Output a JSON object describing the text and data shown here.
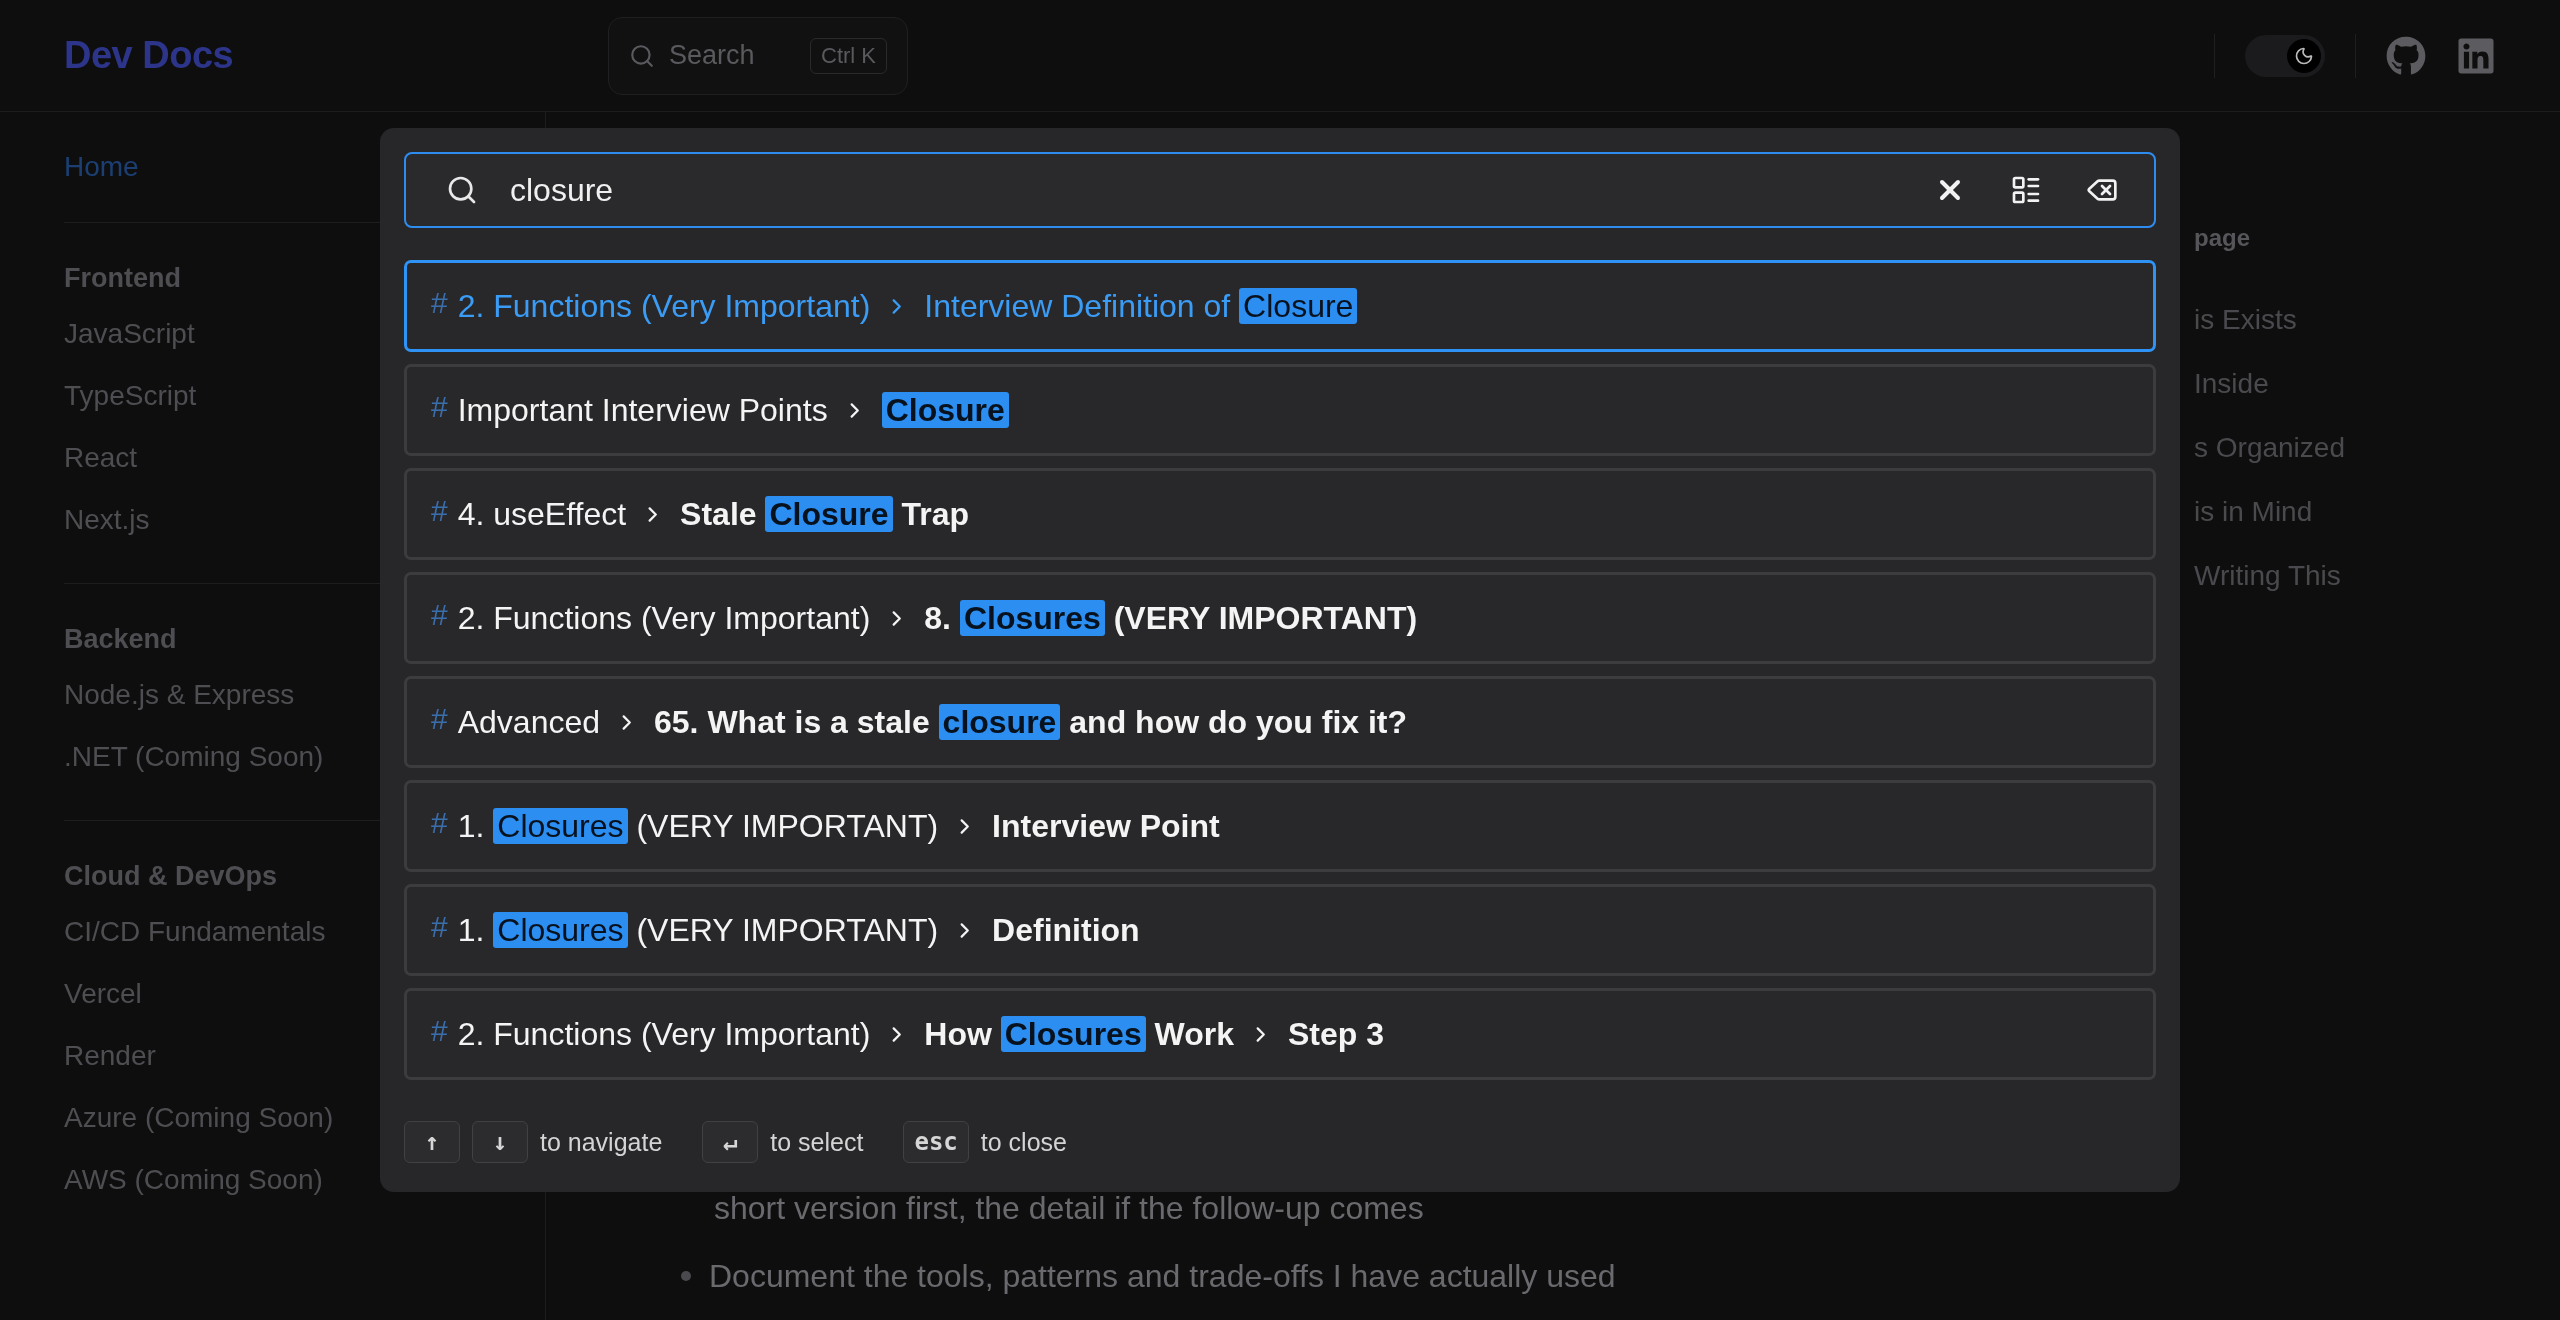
{
  "header": {
    "logo": "Dev Docs",
    "search": {
      "label": "Search",
      "shortcut": "Ctrl K"
    },
    "theme_toggle": {
      "on": true
    }
  },
  "sidebar": {
    "items": [
      {
        "label": "Home",
        "selected": true
      }
    ],
    "sections": [
      {
        "title": "Frontend",
        "items": [
          {
            "label": "JavaScript",
            "selected": false
          },
          {
            "label": "TypeScript",
            "selected": false
          },
          {
            "label": "React",
            "selected": false
          },
          {
            "label": "Next.js",
            "selected": false
          }
        ]
      },
      {
        "title": "Backend",
        "items": [
          {
            "label": "Node.js & Express",
            "selected": false
          },
          {
            "label": ".NET (Coming Soon)",
            "selected": false
          }
        ]
      },
      {
        "title": "Cloud & DevOps",
        "items": [
          {
            "label": "CI/CD Fundamentals",
            "selected": false
          },
          {
            "label": "Vercel",
            "selected": false
          },
          {
            "label": "Render",
            "selected": false
          },
          {
            "label": "Azure (Coming Soon)",
            "selected": false
          },
          {
            "label": "AWS (Coming Soon)",
            "selected": false
          }
        ]
      }
    ]
  },
  "content": {
    "lines": [
      {
        "kind": "continuation",
        "text": "short version first, the detail if the follow-up comes"
      },
      {
        "kind": "bullet",
        "text": "Document the tools, patterns and trade-offs I have actually used"
      }
    ]
  },
  "toc": {
    "heading": "page",
    "items": [
      "is Exists",
      "Inside",
      "s Organized",
      "is in Mind",
      "Writing This"
    ]
  },
  "search_dialog": {
    "query": "closure",
    "results": [
      {
        "icon": "#",
        "selected": true,
        "crumbs": [
          [
            {
              "text": "2. Functions (Very Important)",
              "highlight": false
            }
          ],
          [
            {
              "text": "Interview Definition of ",
              "highlight": false
            },
            {
              "text": "Closure",
              "highlight": true
            }
          ]
        ]
      },
      {
        "icon": "#",
        "selected": false,
        "crumbs": [
          [
            {
              "text": "Important Interview Points",
              "highlight": false
            }
          ],
          [
            {
              "text": "Closure",
              "highlight": true
            }
          ]
        ]
      },
      {
        "icon": "#",
        "selected": false,
        "crumbs": [
          [
            {
              "text": "4. useEffect",
              "highlight": false
            }
          ],
          [
            {
              "text": "Stale ",
              "highlight": false
            },
            {
              "text": "Closure",
              "highlight": true
            },
            {
              "text": " Trap",
              "highlight": false
            }
          ]
        ]
      },
      {
        "icon": "#",
        "selected": false,
        "crumbs": [
          [
            {
              "text": "2. Functions (Very Important)",
              "highlight": false
            }
          ],
          [
            {
              "text": "8. ",
              "highlight": false
            },
            {
              "text": "Closures",
              "highlight": true
            },
            {
              "text": " (VERY IMPORTANT)",
              "highlight": false
            }
          ]
        ]
      },
      {
        "icon": "#",
        "selected": false,
        "crumbs": [
          [
            {
              "text": "Advanced",
              "highlight": false
            }
          ],
          [
            {
              "text": "65. What is a stale ",
              "highlight": false
            },
            {
              "text": "closure",
              "highlight": true
            },
            {
              "text": " and how do you fix it?",
              "highlight": false
            }
          ]
        ]
      },
      {
        "icon": "#",
        "selected": false,
        "crumbs": [
          [
            {
              "text": "1. ",
              "highlight": false
            },
            {
              "text": "Closures",
              "highlight": true
            },
            {
              "text": " (VERY IMPORTANT)",
              "highlight": false
            }
          ],
          [
            {
              "text": "Interview Point",
              "highlight": false
            }
          ]
        ]
      },
      {
        "icon": "#",
        "selected": false,
        "crumbs": [
          [
            {
              "text": "1. ",
              "highlight": false
            },
            {
              "text": "Closures",
              "highlight": true
            },
            {
              "text": " (VERY IMPORTANT)",
              "highlight": false
            }
          ],
          [
            {
              "text": "Definition",
              "highlight": false
            }
          ]
        ]
      },
      {
        "icon": "#",
        "selected": false,
        "crumbs": [
          [
            {
              "text": "2. Functions (Very Important)",
              "highlight": false
            }
          ],
          [
            {
              "text": "How ",
              "highlight": false
            },
            {
              "text": "Closures",
              "highlight": true
            },
            {
              "text": " Work",
              "highlight": false
            }
          ],
          [
            {
              "text": "Step 3",
              "highlight": false
            }
          ]
        ]
      }
    ],
    "footer": [
      {
        "keys": [
          "↑",
          "↓"
        ],
        "label": "to navigate"
      },
      {
        "keys": [
          "↵"
        ],
        "label": "to select"
      },
      {
        "keys": [
          "esc"
        ],
        "label": "to close"
      }
    ]
  }
}
